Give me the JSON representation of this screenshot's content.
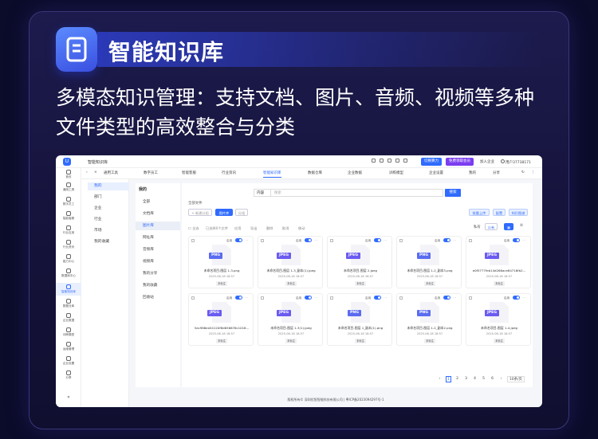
{
  "hero": {
    "title": "智能知识库",
    "description": "多模态知识管理：支持文档、图片、音频、视频等多种文件类型的高效整合与分类"
  },
  "app": {
    "title": "智能知识库",
    "top_buttons": [
      "切换算力",
      "免费领取会员"
    ],
    "top_links": [
      "加入企业",
      "我的"
    ],
    "user": "用户37738171"
  },
  "sidebar": {
    "items": [
      {
        "label": "首页",
        "icon": "home-icon"
      },
      {
        "label": "通用工具",
        "icon": "tools-icon"
      },
      {
        "label": "数字员工",
        "icon": "employee-icon"
      },
      {
        "label": "智能客服",
        "icon": "service-icon"
      },
      {
        "label": "行业应用",
        "icon": "industry-icon"
      },
      {
        "label": "行业资讯",
        "icon": "news-icon"
      },
      {
        "label": "能力中心",
        "icon": "ability-icon"
      },
      {
        "label": "数据库中心",
        "icon": "database-icon"
      },
      {
        "label": "智能知识库",
        "icon": "knowledge-icon",
        "active": true
      },
      {
        "label": "数据仓库",
        "icon": "warehouse-icon"
      },
      {
        "label": "企业数据",
        "icon": "enterprise-data-icon"
      },
      {
        "label": "训练模型",
        "icon": "model-icon"
      },
      {
        "label": "运维管理",
        "icon": "ops-icon"
      },
      {
        "label": "企业设置",
        "icon": "settings-icon"
      },
      {
        "label": "分享",
        "icon": "share-icon"
      }
    ]
  },
  "tabs": [
    {
      "label": "通用工具"
    },
    {
      "label": "数字员工"
    },
    {
      "label": "智能客服"
    },
    {
      "label": "行业资讯"
    },
    {
      "label": "智能知识库",
      "active": true
    },
    {
      "label": "数据仓库"
    },
    {
      "label": "企业数据"
    },
    {
      "label": "训练模型"
    },
    {
      "label": "企业设置"
    },
    {
      "label": "我的"
    },
    {
      "label": "分享"
    }
  ],
  "subnav": {
    "items": [
      "我的",
      "部门",
      "企业",
      "行业",
      "市场",
      "我的收藏"
    ],
    "active_index": 0
  },
  "category": {
    "heading": "我的",
    "items": [
      "全部",
      "文档库",
      "图片库",
      "网址库",
      "音频库",
      "视频库",
      "我的分享",
      "我的收藏",
      "回收站"
    ],
    "active_index": 2
  },
  "search": {
    "select_value": "内容",
    "placeholder": "搜索",
    "button": "搜索"
  },
  "toolbar": {
    "all_files": "全部文件",
    "new_label": "+ 新建分组",
    "filter_image": "图片库",
    "filter_group": "分组",
    "right_buttons": [
      "批量上传",
      "配置",
      "知识图谱"
    ],
    "view_private": "私有",
    "view_public": "公有",
    "select_all": "全选",
    "selected": "已选择0个文件",
    "actions": [
      "应用",
      "导出",
      "删除",
      "取消",
      "移动"
    ]
  },
  "files": [
    {
      "type": "PNG",
      "color": "#5b6cf0",
      "name": "未命名项目-图层 1-3.png",
      "date": "2025-06-18 18:57",
      "tag": "未标注"
    },
    {
      "type": "JPEG",
      "color": "#6b5bf0",
      "name": "未命名项目-图层 1-3_副本(1).jpeg",
      "date": "2025-06-18 18:57",
      "tag": "未标注"
    },
    {
      "type": "JPEG",
      "color": "#6b5bf0",
      "name": "未命名项目-图层 2.jpeg",
      "date": "2025-06-18 18:57",
      "tag": "未标注"
    },
    {
      "type": "PNG",
      "color": "#5b6cf0",
      "name": "未命名项目-图层 1-2_副本3.png",
      "date": "2025-06-18 18:57",
      "tag": "未标注"
    },
    {
      "type": "JPEG",
      "color": "#6b5bf0",
      "name": "e0f5777feb14d266ace84716fb2...",
      "date": "2025-06-18 18:57",
      "tag": "未标注"
    },
    {
      "type": "JPEG",
      "color": "#6b5bf0",
      "name": "5ac986ea54120f8d656676c1018...",
      "date": "2025-06-18 18:57",
      "tag": "未标注"
    },
    {
      "type": "JPEG",
      "color": "#6b5bf0",
      "name": "未命名项目-图层 1-3(1).jpeg",
      "date": "2025-06-18 18:57",
      "tag": "未标注"
    },
    {
      "type": "PNG",
      "color": "#5b6cf0",
      "name": "未命名项目-图层 1_副本(1).png",
      "date": "2025-06-18 18:57",
      "tag": "未标注"
    },
    {
      "type": "PNG",
      "color": "#5b6cf0",
      "name": "未命名项目-图层 1-2_副本2.png",
      "date": "2025-06-18 18:57",
      "tag": "未标注"
    },
    {
      "type": "JPEG",
      "color": "#6b5bf0",
      "name": "未命名项目-图层 1-4.jpeg",
      "date": "2025-06-18 18:57",
      "tag": "未标注"
    }
  ],
  "card_switch_label": "启用",
  "pagination": {
    "pages": [
      "1",
      "2",
      "3",
      "4",
      "5",
      "6"
    ],
    "current": "1",
    "size": "10条/页"
  },
  "footer": "版权所有© 深圳优智智能科技有限公司 | 粤ICP备2023094297号-1"
}
